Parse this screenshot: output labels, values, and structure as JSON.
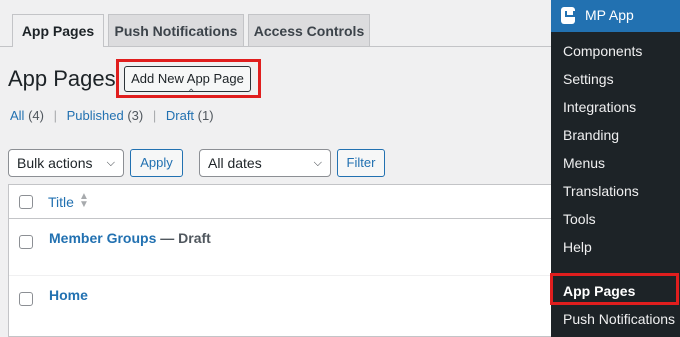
{
  "tabs": [
    {
      "label": "App Pages"
    },
    {
      "label": "Push Notifications"
    },
    {
      "label": "Access Controls"
    }
  ],
  "page": {
    "title": "App Pages",
    "add_new_label": "Add New App Page"
  },
  "filters_links": {
    "all_label": "All",
    "all_count": "(4)",
    "published_label": "Published",
    "published_count": "(3)",
    "draft_label": "Draft",
    "draft_count": "(1)"
  },
  "bulk": {
    "selected": "Bulk actions",
    "apply_label": "Apply"
  },
  "dates": {
    "selected": "All dates",
    "filter_label": "Filter"
  },
  "table": {
    "title_header": "Title",
    "rows": [
      {
        "title": "Member Groups",
        "state": " — Draft"
      },
      {
        "title": "Home",
        "state": ""
      }
    ]
  },
  "sidebar": {
    "app_name": "MP App",
    "items": [
      {
        "label": "Components"
      },
      {
        "label": "Settings"
      },
      {
        "label": "Integrations"
      },
      {
        "label": "Branding"
      },
      {
        "label": "Menus"
      },
      {
        "label": "Translations"
      },
      {
        "label": "Tools"
      },
      {
        "label": "Help"
      },
      {
        "label": "App Pages"
      },
      {
        "label": "Push Notifications"
      }
    ]
  },
  "colors": {
    "link": "#2271b1",
    "highlight": "#e01e1e",
    "sidebar_bg": "#1d2327",
    "sidebar_header": "#2271b1"
  }
}
